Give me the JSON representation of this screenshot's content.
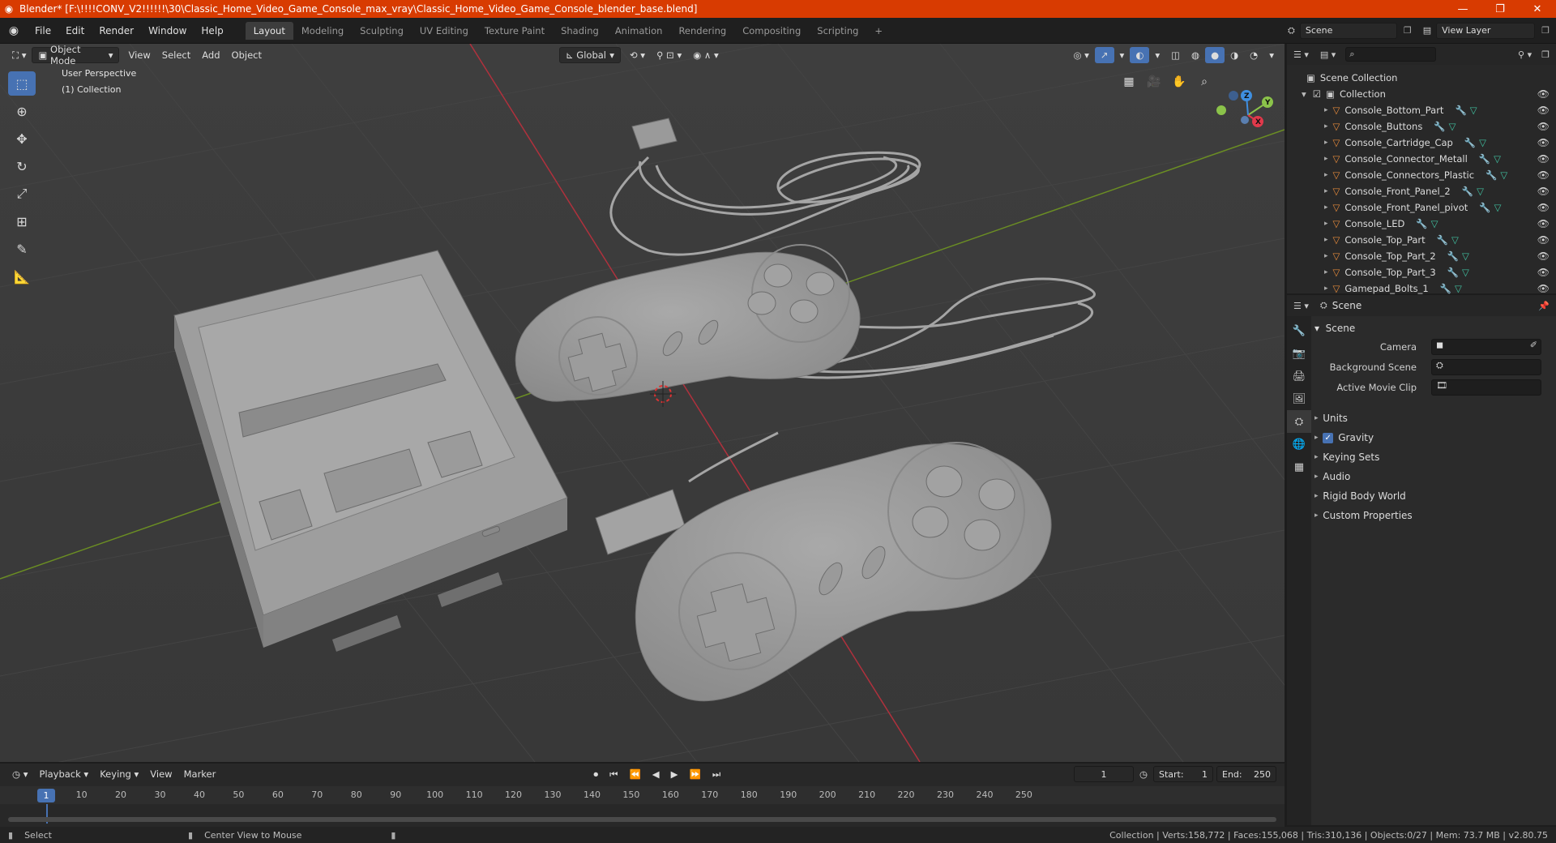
{
  "window": {
    "title": "Blender* [F:\\!!!!CONV_V2!!!!!!\\30\\Classic_Home_Video_Game_Console_max_vray\\Classic_Home_Video_Game_Console_blender_base.blend]",
    "minimize": "—",
    "maximize": "❐",
    "close": "✕"
  },
  "menubar": {
    "menus": [
      "File",
      "Edit",
      "Render",
      "Window",
      "Help"
    ],
    "workspaces": [
      "Layout",
      "Modeling",
      "Sculpting",
      "UV Editing",
      "Texture Paint",
      "Shading",
      "Animation",
      "Rendering",
      "Compositing",
      "Scripting"
    ],
    "active_workspace": "Layout",
    "add_tab": "+",
    "scene_name": "Scene",
    "view_layer": "View Layer"
  },
  "viewport": {
    "mode": "Object Mode",
    "menus": [
      "View",
      "Select",
      "Add",
      "Object"
    ],
    "orientation": "Global",
    "overlay_text_1": "User Perspective",
    "overlay_text_2": "(1) Collection",
    "gizmo_axes": [
      "X",
      "Y",
      "Z"
    ]
  },
  "outliner": {
    "search_placeholder": "",
    "root": "Scene Collection",
    "collection": "Collection",
    "objects": [
      "Console_Bottom_Part",
      "Console_Buttons",
      "Console_Cartridge_Cap",
      "Console_Connector_Metall",
      "Console_Connectors_Plastic",
      "Console_Front_Panel_2",
      "Console_Front_Panel_pivot",
      "Console_LED",
      "Console_Top_Part",
      "Console_Top_Part_2",
      "Console_Top_Part_3",
      "Gamepad_Bolts_1"
    ]
  },
  "properties": {
    "context": "Scene",
    "panel_title": "Scene",
    "fields": [
      {
        "label": "Camera",
        "value": ""
      },
      {
        "label": "Background Scene",
        "value": ""
      },
      {
        "label": "Active Movie Clip",
        "value": ""
      }
    ],
    "subpanels": [
      "Units",
      "Gravity",
      "Keying Sets",
      "Audio",
      "Rigid Body World",
      "Custom Properties"
    ],
    "gravity_checked": true
  },
  "timeline": {
    "menus": [
      "Playback",
      "Keying",
      "View",
      "Marker"
    ],
    "current_frame": "1",
    "start_label": "Start:",
    "start": "1",
    "end_label": "End:",
    "end": "250",
    "ruler": [
      "1",
      "10",
      "20",
      "30",
      "40",
      "50",
      "60",
      "70",
      "80",
      "90",
      "100",
      "110",
      "120",
      "130",
      "140",
      "150",
      "160",
      "170",
      "180",
      "190",
      "200",
      "210",
      "220",
      "230",
      "240",
      "250"
    ]
  },
  "statusbar": {
    "left_action": "Select",
    "middle_action": "Center View to Mouse",
    "stats": "Collection | Verts:158,772 | Faces:155,068 | Tris:310,136 | Objects:0/27 | Mem: 73.7 MB | v2.80.75"
  },
  "colors": {
    "title_bar": "#d83b01",
    "accent": "#4772b3",
    "object_icon": "#e88b3b",
    "mesh_icon": "#40c0a0",
    "x_axis": "#e0394b",
    "y_axis": "#8bc34a",
    "z_axis": "#3f8fe0"
  }
}
